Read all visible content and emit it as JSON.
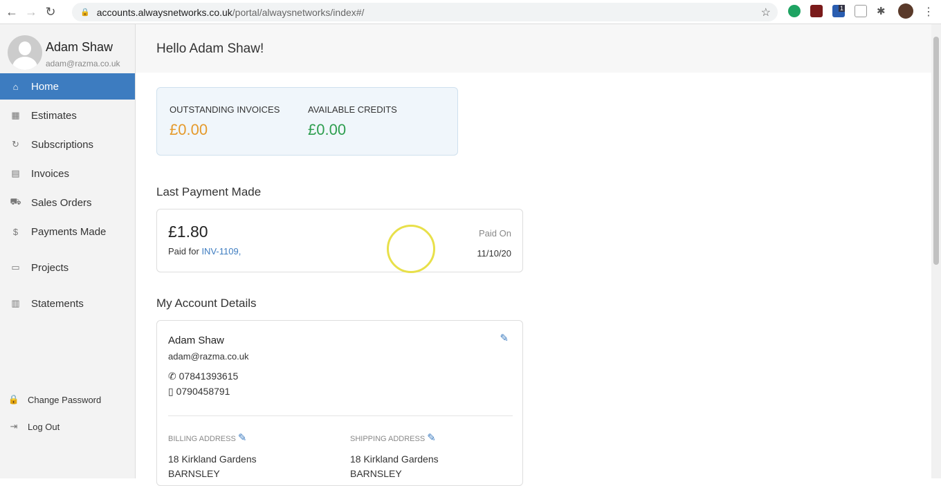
{
  "browser": {
    "url_host": "accounts.alwaysnetworks.co.uk",
    "url_path": "/portal/alwaysnetworks/index#/",
    "ext_badge": "1"
  },
  "user": {
    "name": "Adam Shaw",
    "email": "adam@razma.co.uk"
  },
  "sidebar": {
    "items": [
      {
        "label": "Home",
        "icon": "home-icon"
      },
      {
        "label": "Estimates",
        "icon": "estimate-icon"
      },
      {
        "label": "Subscriptions",
        "icon": "subscription-icon"
      },
      {
        "label": "Invoices",
        "icon": "invoice-icon"
      },
      {
        "label": "Sales Orders",
        "icon": "cart-icon"
      },
      {
        "label": "Payments Made",
        "icon": "dollar-icon"
      },
      {
        "label": "Projects",
        "icon": "briefcase-icon"
      },
      {
        "label": "Statements",
        "icon": "statement-icon"
      }
    ],
    "bottom": [
      {
        "label": "Change Password",
        "icon": "lock-icon"
      },
      {
        "label": "Log Out",
        "icon": "logout-icon"
      }
    ]
  },
  "main": {
    "greeting": "Hello Adam Shaw!",
    "summary": {
      "outstanding_label": "OUTSTANDING INVOICES",
      "outstanding_value": "£0.00",
      "credits_label": "AVAILABLE CREDITS",
      "credits_value": "£0.00",
      "outstanding_color": "#e59a2c",
      "credits_color": "#2e9e4f"
    },
    "last_payment": {
      "title": "Last Payment Made",
      "amount": "£1.80",
      "paid_for_label": "Paid for",
      "invoice": "INV-1109",
      "comma": ",",
      "paid_on_label": "Paid On",
      "date": "11/10/20"
    },
    "account": {
      "title": "My Account Details",
      "name": "Adam Shaw",
      "email": "adam@razma.co.uk",
      "phone": "07841393615",
      "mobile": "0790458791",
      "billing_label": "BILLING ADDRESS",
      "billing_line1": "18 Kirkland Gardens",
      "billing_line2": "BARNSLEY",
      "shipping_label": "SHIPPING ADDRESS",
      "shipping_line1": "18 Kirkland Gardens",
      "shipping_line2": "BARNSLEY"
    }
  }
}
